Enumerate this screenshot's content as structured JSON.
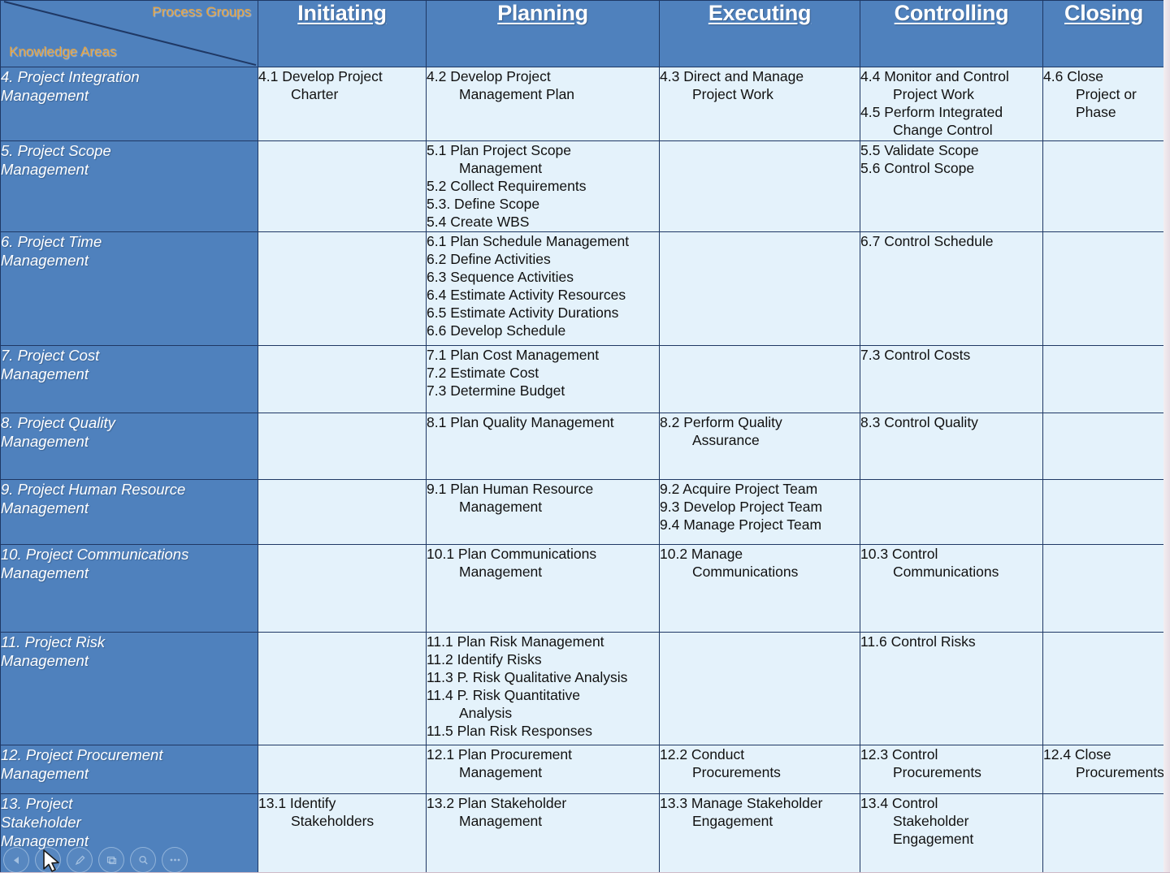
{
  "slide": {
    "corner": {
      "process_groups_label": "Process Groups",
      "knowledge_areas_label": "Knowledge Areas"
    },
    "colors": {
      "header_blue": "#4f81bd",
      "cell_blue": "#e4f2fb",
      "border_navy": "#1f3864",
      "corner_label_orange": "#e8a33d",
      "header_text": "#ffffff"
    }
  },
  "columns": [
    {
      "key": "initiating",
      "label": "Initiating"
    },
    {
      "key": "planning",
      "label": "Planning"
    },
    {
      "key": "executing",
      "label": "Executing"
    },
    {
      "key": "controlling",
      "label": "Controlling"
    },
    {
      "key": "closing",
      "label": "Closing"
    }
  ],
  "rows": [
    {
      "area": "4. Project Integration\n    Management",
      "initiating": [
        "4.1 Develop Project\n      Charter"
      ],
      "planning": [
        "4.2 Develop Project\n      Management Plan"
      ],
      "executing": [
        "4.3 Direct and  Manage\n      Project Work"
      ],
      "controlling": [
        "4.4 Monitor and Control\n      Project Work",
        "4.5 Perform Integrated\n      Change Control"
      ],
      "closing": [
        "4.6 Close\n      Project or\n      Phase"
      ]
    },
    {
      "area": "5. Project Scope\n    Management",
      "initiating": [],
      "planning": [
        "5.1 Plan Project Scope\n      Management",
        "5.2 Collect Requirements",
        "5.3. Define Scope",
        "5.4 Create WBS"
      ],
      "executing": [],
      "controlling": [
        "5.5 Validate Scope",
        "5.6 Control Scope"
      ],
      "closing": []
    },
    {
      "area": "6. Project Time\n    Management",
      "initiating": [],
      "planning": [
        "6.1 Plan Schedule Management",
        "6.2 Define Activities",
        "6.3 Sequence Activities",
        "6.4 Estimate Activity Resources",
        "6.5 Estimate Activity Durations",
        "6.6 Develop Schedule"
      ],
      "executing": [],
      "controlling": [
        "6.7 Control Schedule"
      ],
      "closing": []
    },
    {
      "area": "7. Project Cost\n    Management",
      "initiating": [],
      "planning": [
        "7.1 Plan Cost Management",
        "7.2 Estimate Cost",
        "7.3 Determine Budget"
      ],
      "executing": [],
      "controlling": [
        "7.3 Control Costs"
      ],
      "closing": []
    },
    {
      "area": "8. Project Quality\n    Management",
      "initiating": [],
      "planning": [
        "8.1 Plan Quality Management"
      ],
      "executing": [
        "8.2 Perform Quality\n      Assurance"
      ],
      "controlling": [
        "8.3 Control Quality"
      ],
      "closing": []
    },
    {
      "area": "9. Project Human Resource\nManagement",
      "initiating": [],
      "planning": [
        "9.1 Plan Human Resource\n      Management"
      ],
      "executing": [
        "9.2 Acquire Project Team",
        "9.3 Develop Project Team",
        "9.4 Manage Project Team"
      ],
      "controlling": [],
      "closing": []
    },
    {
      "area": "10. Project Communications\n      Management",
      "initiating": [],
      "planning": [
        "10.1 Plan Communications\n        Management"
      ],
      "executing": [
        "10.2 Manage\n        Communications"
      ],
      "controlling": [
        "10.3 Control\n        Communications"
      ],
      "closing": []
    },
    {
      "area": "11. Project Risk\n      Management",
      "initiating": [],
      "planning": [
        "11.1 Plan Risk Management",
        "11.2 Identify Risks",
        "11.3 P. Risk Qualitative Analysis",
        "11.4 P. Risk Quantitative\n        Analysis",
        "11.5 Plan Risk Responses"
      ],
      "executing": [],
      "controlling": [
        "11.6 Control Risks"
      ],
      "closing": []
    },
    {
      "area": "12. Project Procurement\n      Management",
      "initiating": [],
      "planning": [
        "12.1 Plan Procurement\n        Management"
      ],
      "executing": [
        "12.2 Conduct\n        Procurements"
      ],
      "controlling": [
        "12.3 Control\n        Procurements"
      ],
      "closing": [
        "12.4 Close\nProcurements"
      ]
    },
    {
      "area": "13. Project\n      Stakeholder\n      Management",
      "initiating": [
        "13.1 Identify\n        Stakeholders"
      ],
      "planning": [
        "13.2 Plan Stakeholder\n        Management"
      ],
      "executing": [
        "13.3 Manage Stakeholder\n        Engagement"
      ],
      "controlling": [
        "13.4 Control\n        Stakeholder\n        Engagement"
      ],
      "closing": []
    }
  ],
  "toolbar": {
    "buttons": [
      {
        "icon": "previous-slide-icon",
        "label": "Previous"
      },
      {
        "icon": "next-slide-icon",
        "label": "Next"
      },
      {
        "icon": "pen-icon",
        "label": "Pen"
      },
      {
        "icon": "all-slides-icon",
        "label": "All Slides"
      },
      {
        "icon": "zoom-icon",
        "label": "Zoom"
      },
      {
        "icon": "more-options-icon",
        "label": "More"
      }
    ]
  }
}
